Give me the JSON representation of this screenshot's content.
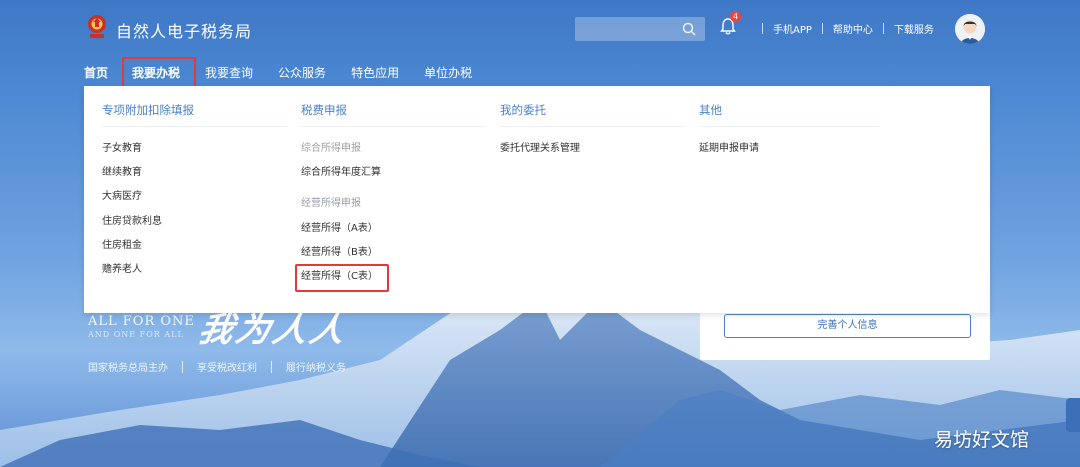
{
  "header": {
    "site_title": "自然人电子税务局",
    "search": {
      "placeholder": ""
    },
    "notification_count": "4",
    "links": [
      "手机APP",
      "帮助中心",
      "下载服务"
    ]
  },
  "nav": {
    "items": [
      "首页",
      "我要办税",
      "我要查询",
      "公众服务",
      "特色应用",
      "单位办税"
    ],
    "active_index": 1
  },
  "dropdown": {
    "columns": [
      {
        "heading": "专项附加扣除填报",
        "items": [
          {
            "label": "子女教育",
            "type": "link"
          },
          {
            "label": "继续教育",
            "type": "link"
          },
          {
            "label": "大病医疗",
            "type": "link"
          },
          {
            "label": "住房贷款利息",
            "type": "link"
          },
          {
            "label": "住房租金",
            "type": "link"
          },
          {
            "label": "赡养老人",
            "type": "link"
          }
        ]
      },
      {
        "heading": "税费申报",
        "items": [
          {
            "label": "综合所得申报",
            "type": "group"
          },
          {
            "label": "综合所得年度汇算",
            "type": "link"
          },
          {
            "label": "经营所得申报",
            "type": "group"
          },
          {
            "label": "经营所得（A表）",
            "type": "link"
          },
          {
            "label": "经营所得（B表）",
            "type": "link"
          },
          {
            "label": "经营所得（C表）",
            "type": "link",
            "highlighted": true
          }
        ]
      },
      {
        "heading": "我的委托",
        "items": [
          {
            "label": "委托代理关系管理",
            "type": "link"
          }
        ]
      },
      {
        "heading": "其他",
        "items": [
          {
            "label": "延期申报申请",
            "type": "link"
          }
        ]
      }
    ]
  },
  "hero": {
    "line1": "ALL FOR ONE",
    "line2": "AND ONE FOR ALL",
    "script_text": "我为人人",
    "tags": [
      "国家税务总局主办",
      "享受税改红利",
      "履行纳税义务"
    ]
  },
  "card": {
    "button_label": "完善个人信息"
  },
  "watermark": "易坊好文馆",
  "colors": {
    "accent": "#4a82c9",
    "highlight_border": "#e23a3a",
    "header_bg": "#3f78c6"
  }
}
